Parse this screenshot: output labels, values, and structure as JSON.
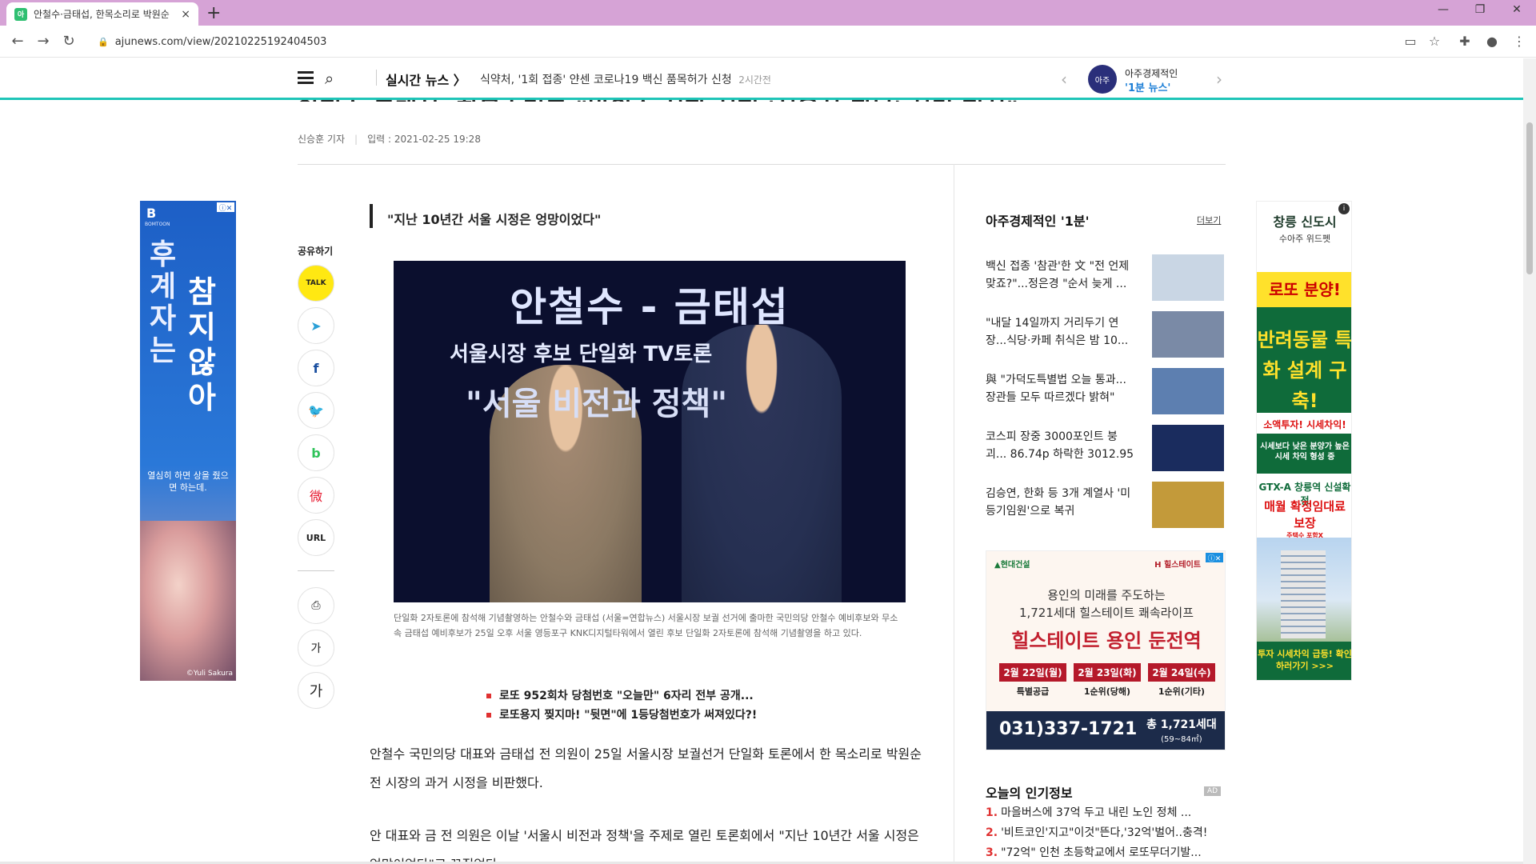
{
  "browser": {
    "tab_title": "안철수·금태섭, 한목소리로 박원순",
    "favicon_text": "아",
    "url": "ajunews.com/view/20210225192404503",
    "new_tab_symbol": "+",
    "tab_close_symbol": "×"
  },
  "site_header": {
    "live_label": "실시간 뉴스 〉",
    "live_headline": "식약처, '1회 접종' 얀센 코로나19 백신 품목허가 신청",
    "live_time": "2시간전",
    "onemin_logo": "아주",
    "onemin_top": "아주경제적인",
    "onemin_bottom": "'1분 뉴스'"
  },
  "article": {
    "title_partial": "안철수·금태섭, 한목소리로 \"박원순 시장 시절 '서울시 퇴보' 시킨 정치\"",
    "reporter": "신승훈 기자",
    "date": "입력 : 2021-02-25 19:28",
    "subtitle": "\"지난 10년간 서울 시정은 엉망이었다\"",
    "share_label": "공유하기",
    "photo": {
      "line1": "안철수 - 금태섭",
      "line2": "서울시장 후보 단일화 TV토론",
      "line3": "\"서울 비전과 정책\""
    },
    "caption": "단일화 2자토론에 참석해 기념촬영하는 안철수와 금태섭 (서울=연합뉴스) 서울시장 보궐 선거에 출마한 국민의당 안철수 예비후보와 무소속 금태섭 예비후보가 25일 오후 서울 영등포구 KNK디지털타워에서 열린 후보 단일화 2자토론에 참석해 기념촬영을 하고 있다.",
    "related": [
      "로또 952회차 당첨번호 \"오늘만\" 6자리 전부 공개...",
      "로또용지 찢지마! \"뒷면\"에 1등당첨번호가 써져있다?!"
    ],
    "paragraphs": [
      "안철수 국민의당 대표와 금태섭 전 의원이 25일 서울시장 보궐선거 단일화 토론에서 한 목소리로 박원순 전 시장의 과거 시정을 비판했다.",
      "안 대표와 금 전 의원은 이날 '서울시 비전과 정책'을 주제로 열린 토론회에서 \"지난 10년간 서울 시정은 엉망이었다\"고 꼬집었다."
    ]
  },
  "share_buttons": [
    {
      "label": "TALK",
      "icon": "kakaotalk-icon"
    },
    {
      "label": "➤",
      "icon": "telegram-icon"
    },
    {
      "label": "f",
      "icon": "facebook-icon"
    },
    {
      "label": "🐦",
      "icon": "twitter-icon"
    },
    {
      "label": "b",
      "icon": "band-icon"
    },
    {
      "label": "微",
      "icon": "weibo-icon"
    },
    {
      "label": "URL",
      "icon": "url-copy-icon"
    }
  ],
  "tool_buttons": [
    {
      "label": "⎙",
      "icon": "print-icon"
    },
    {
      "label": "가",
      "icon": "font-decrease-icon"
    },
    {
      "label": "가",
      "icon": "font-increase-icon"
    }
  ],
  "right_column": {
    "title": "아주경제적인 '1분'",
    "more": "더보기",
    "items": [
      {
        "text": "백신 접종 '참관'한 文 \"전 언제 맞죠?\"...정은경 \"순서 늦게 ...",
        "color": "#c9d6e4"
      },
      {
        "text": "\"내달 14일까지 거리두기 연장...식당·카페 취식은 밤 10...",
        "color": "#7a8aa6"
      },
      {
        "text": "與 \"가덕도특별법 오늘 통과...장관들 모두 따르겠다 밝혀\"",
        "color": "#5d7fb0"
      },
      {
        "text": "코스피 장중 3000포인트 붕괴... 86.74p 하락한 3012.95 ...",
        "color": "#1a2c5e"
      },
      {
        "text": "김승연, 한화 등 3개 계열사 '미등기임원'으로 복귀",
        "color": "#c39a3a"
      }
    ],
    "popular_title": "오늘의 인기정보",
    "ad_badge": "AD",
    "popular": [
      {
        "n": "1.",
        "text": "마을버스에 37억 두고 내린 노인 정체 ..."
      },
      {
        "n": "2.",
        "text": "'비트코인'지고\"이것\"뜬다,'32억'벌어..충격!"
      },
      {
        "n": "3.",
        "text": "\"72억\" 인천 초등학교에서 로또무더기발..."
      }
    ]
  },
  "ads": {
    "left": {
      "brand": "B",
      "brand_sub": "BOMTOON",
      "close": "ⓘ✕",
      "big1": "후계자는",
      "big2": "참지않아",
      "small": "열심히 하면 상을 줬으면 하는데.",
      "credit": "©Yuli Sakura"
    },
    "hill": {
      "builder": "▲현대건설",
      "brand": "H 힐스테이트",
      "close": "ⓘ✕",
      "line1": "용인의 미래를 주도하는",
      "line2": "1,721세대 힐스테이트 쾌속라이프",
      "line3": "힐스테이트 용인 둔전역",
      "dates": [
        {
          "d": "2월 22일(월)",
          "s": "특별공급"
        },
        {
          "d": "2월 23일(화)",
          "s": "1순위(당해)"
        },
        {
          "d": "2월 24일(수)",
          "s": "1순위(기타)"
        }
      ],
      "phone": "031)337-1721",
      "total": "총 1,721세대",
      "total_sub": "(59~84㎡)"
    },
    "right": {
      "info": "i",
      "r1": "창릉 신도시",
      "r2": "수아주 위드펫",
      "r3": "로또 분양!",
      "r4": "반려동물 특화 설계 구축!",
      "r5": "소액투자! 시세차익!",
      "r6": "시세보다 낮은 분양가 높은 시세 차익 형성 중",
      "r7": "GTX-A 창릉역 신설확정",
      "r8": "매월 확정임대료 보장",
      "r8_sub": "주택수 포함X",
      "r9": "투자 시세차익 급등! 확인하러가기 >>>"
    }
  },
  "colors": {
    "tabbar": "#d6a3d6",
    "accent_line": "#1fc5b8",
    "bullet": "#e03131"
  }
}
